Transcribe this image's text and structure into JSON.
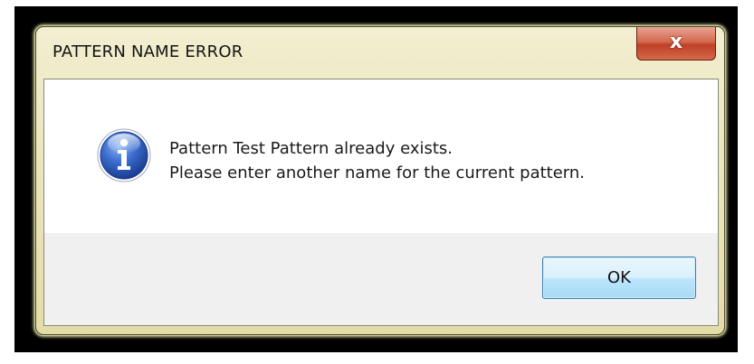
{
  "dialog": {
    "title": "PATTERN NAME ERROR",
    "close_glyph": "x",
    "icon": "information-icon",
    "message_line1": "Pattern Test Pattern already exists.",
    "message_line2": "Please enter another name for the current pattern.",
    "ok_label": "OK"
  },
  "colors": {
    "frame_border": "#000000",
    "window_chrome": "#ece6be",
    "close_button": "#c04025",
    "ok_button": "#bee6fd",
    "icon_blue": "#2a5cb8"
  }
}
